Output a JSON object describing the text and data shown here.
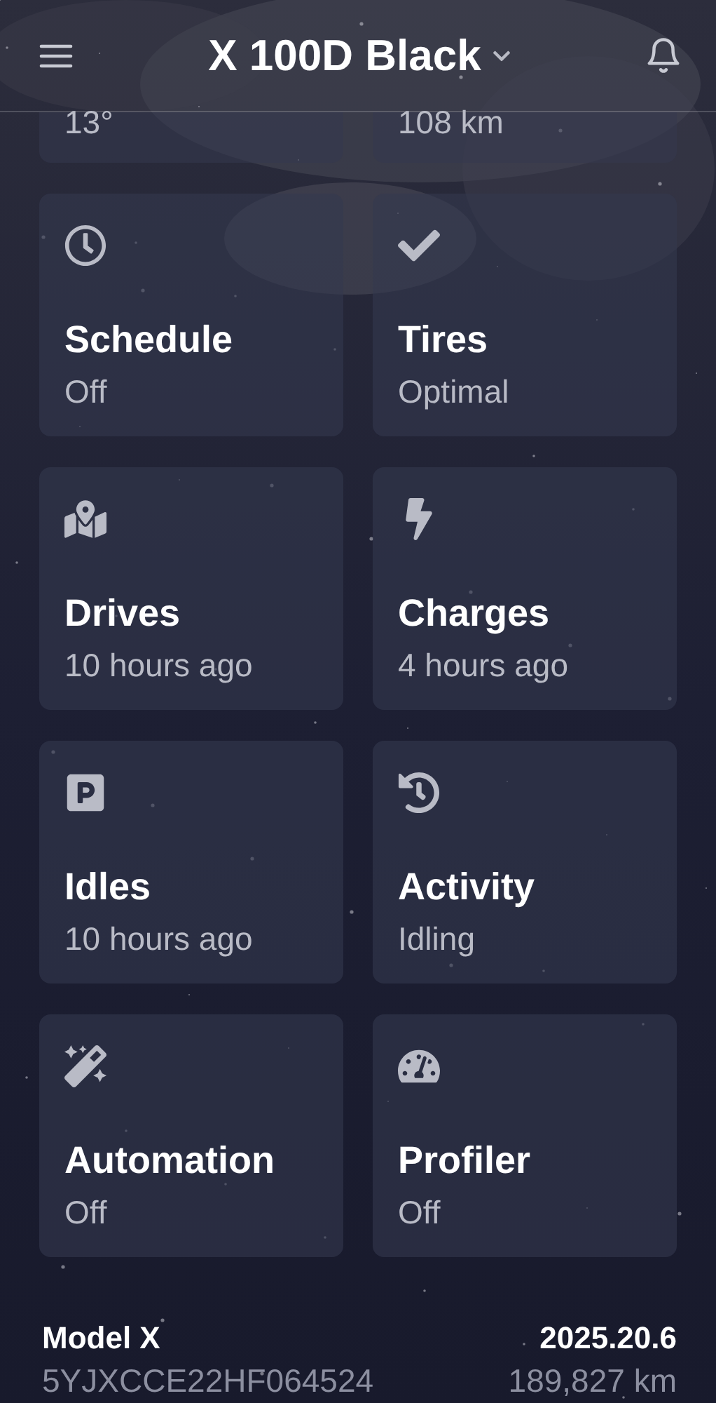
{
  "header": {
    "title": "X 100D Black"
  },
  "partial_cards": [
    {
      "value": "13°"
    },
    {
      "value": "108 km"
    }
  ],
  "cards": [
    {
      "title": "Schedule",
      "subtitle": "Off"
    },
    {
      "title": "Tires",
      "subtitle": "Optimal"
    },
    {
      "title": "Drives",
      "subtitle": "10 hours ago"
    },
    {
      "title": "Charges",
      "subtitle": "4 hours ago"
    },
    {
      "title": "Idles",
      "subtitle": "10 hours ago"
    },
    {
      "title": "Activity",
      "subtitle": "Idling"
    },
    {
      "title": "Automation",
      "subtitle": "Off"
    },
    {
      "title": "Profiler",
      "subtitle": "Off"
    }
  ],
  "footer": {
    "model": "Model X",
    "version": "2025.20.6",
    "vin": "5YJXCCE22HF064524",
    "odometer": "189,827 km"
  }
}
